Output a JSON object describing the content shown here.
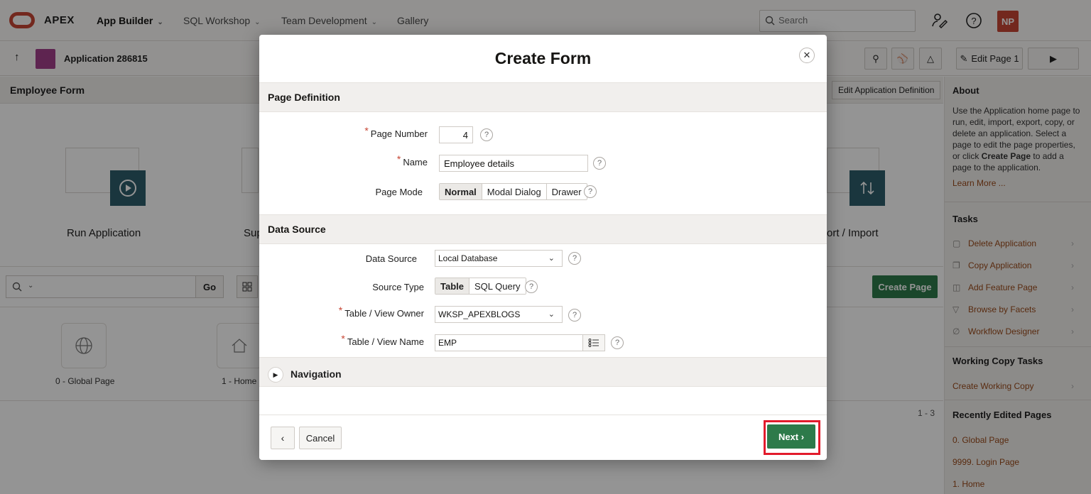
{
  "topnav": {
    "brand": "APEX",
    "items": [
      {
        "label": "App Builder",
        "chevron": "⌵"
      },
      {
        "label": "SQL Workshop",
        "chevron": "⌵"
      },
      {
        "label": "Team Development",
        "chevron": "⌵"
      },
      {
        "label": "Gallery"
      }
    ],
    "search_placeholder": "Search",
    "avatar_initials": "NP"
  },
  "appbar": {
    "app_name": "Application 286815",
    "edit_page_label": "Edit Page 1"
  },
  "background": {
    "page_title": "Employee Form",
    "edit_app_def": "Edit Application Definition",
    "cards": [
      "Run Application",
      "Sup",
      "ort / Import"
    ],
    "go_label": "Go",
    "create_page_label": "Create Page",
    "pages": [
      "0 - Global Page",
      "1 - Home"
    ],
    "pager": "1 - 3"
  },
  "sidebar": {
    "about_title": "About",
    "about_text_1": "Use the Application home page to run, edit, import, export, copy, or delete an application. Select a page to edit the page properties, or click ",
    "about_text_bold": "Create Page",
    "about_text_2": " to add a page to the application.",
    "learn_more": "Learn More ...",
    "tasks_title": "Tasks",
    "tasks": [
      "Delete Application",
      "Copy Application",
      "Add Feature Page",
      "Browse by Facets",
      "Workflow Designer"
    ],
    "working_copy_title": "Working Copy Tasks",
    "working_copy_link": "Create Working Copy",
    "recent_title": "Recently Edited Pages",
    "recent": [
      "0. Global Page",
      "9999. Login Page",
      "1. Home"
    ]
  },
  "dialog": {
    "title": "Create Form",
    "close_glyph": "✕",
    "page_definition": {
      "section_title": "Page Definition",
      "page_number_label": "Page Number",
      "page_number_value": "4",
      "name_label": "Name",
      "name_value": "Employee details",
      "page_mode_label": "Page Mode",
      "page_mode_options": [
        "Normal",
        "Modal Dialog",
        "Drawer"
      ],
      "page_mode_selected": "Normal"
    },
    "data_source": {
      "section_title": "Data Source",
      "data_source_label": "Data Source",
      "data_source_value": "Local Database",
      "source_type_label": "Source Type",
      "source_type_options": [
        "Table",
        "SQL Query"
      ],
      "source_type_selected": "Table",
      "owner_label": "Table / View Owner",
      "owner_value": "WKSP_APEXBLOGS",
      "table_name_label": "Table / View Name",
      "table_name_value": "EMP"
    },
    "navigation": {
      "section_title": "Navigation"
    },
    "footer": {
      "back_glyph": "‹",
      "cancel_label": "Cancel",
      "next_label": "Next ›"
    }
  },
  "help_glyph": "?"
}
